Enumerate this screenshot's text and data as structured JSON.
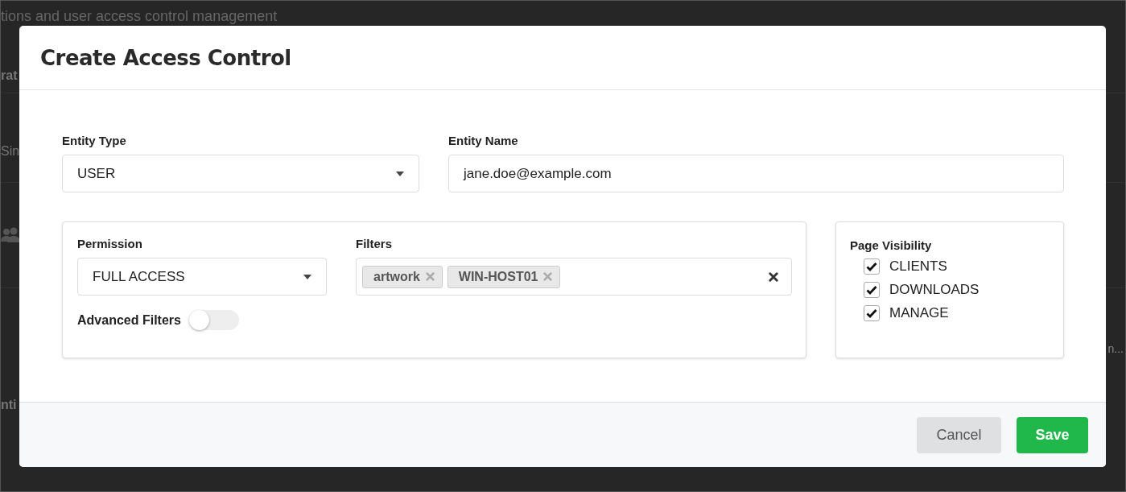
{
  "background": {
    "subtitle": "tions and user access control management",
    "rows": [
      "rat",
      "Sin",
      "nti"
    ],
    "truncated": "n..."
  },
  "dialog": {
    "title": "Create Access Control",
    "entity_type": {
      "label": "Entity Type",
      "value": "USER"
    },
    "entity_name": {
      "label": "Entity Name",
      "value": "jane.doe@example.com"
    },
    "permission": {
      "label": "Permission",
      "value": "FULL ACCESS"
    },
    "filters": {
      "label": "Filters",
      "tags": [
        "artwork",
        "WIN-HOST01"
      ]
    },
    "advanced_filters": {
      "label": "Advanced Filters",
      "on": false
    },
    "page_visibility": {
      "title": "Page Visibility",
      "items": [
        {
          "label": "CLIENTS",
          "checked": true
        },
        {
          "label": "DOWNLOADS",
          "checked": true
        },
        {
          "label": "MANAGE",
          "checked": true
        }
      ]
    },
    "buttons": [
      {
        "label": "Cancel",
        "kind": "secondary"
      },
      {
        "label": "Save",
        "kind": "primary"
      }
    ]
  }
}
